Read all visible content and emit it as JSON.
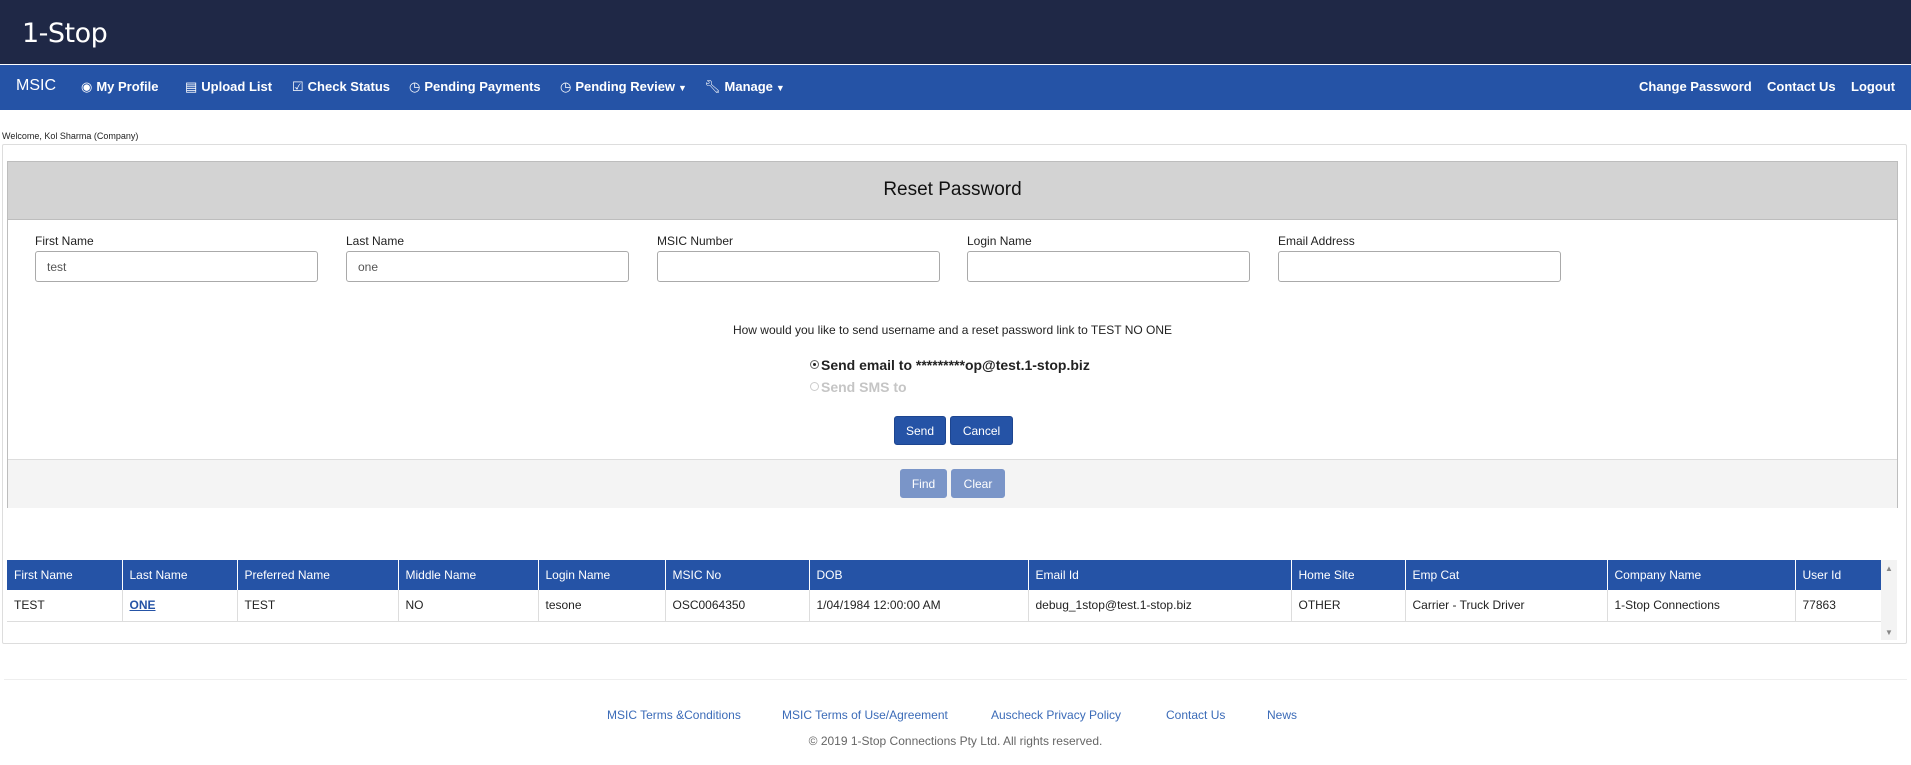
{
  "app": {
    "logo": "1-Stop"
  },
  "nav": {
    "brand": "MSIC",
    "left_items": [
      {
        "label": "My Profile",
        "icon": "user-circle-icon"
      },
      {
        "label": "Upload List",
        "icon": "document-icon"
      },
      {
        "label": "Check Status",
        "icon": "checkbox-icon"
      },
      {
        "label": "Pending Payments",
        "icon": "clock-icon"
      },
      {
        "label": "Pending Review",
        "icon": "clock-icon",
        "dropdown": true
      },
      {
        "label": "Manage",
        "icon": "wrench-icon",
        "dropdown": true
      }
    ],
    "right_items": [
      "Change Password",
      "Contact Us",
      "Logout"
    ]
  },
  "welcome": "Welcome, Kol Sharma (Company)",
  "form": {
    "title": "Reset Password",
    "fields": [
      {
        "label": "First Name",
        "value": "test"
      },
      {
        "label": "Last Name",
        "value": "one"
      },
      {
        "label": "MSIC Number",
        "value": ""
      },
      {
        "label": "Login Name",
        "value": ""
      },
      {
        "label": "Email Address",
        "value": ""
      }
    ],
    "question": "How would you like to send username and a reset password link to TEST NO ONE",
    "options": [
      {
        "label": "Send email to *********op@test.1-stop.biz",
        "checked": true,
        "disabled": false
      },
      {
        "label": "Send SMS to",
        "checked": false,
        "disabled": true
      }
    ],
    "send_label": "Send",
    "cancel_label": "Cancel",
    "find_label": "Find",
    "clear_label": "Clear"
  },
  "table": {
    "columns": [
      "First Name",
      "Last Name",
      "Preferred Name",
      "Middle Name",
      "Login Name",
      "MSIC No",
      "DOB",
      "Email Id",
      "Home Site",
      "Emp Cat",
      "Company Name",
      "User Id"
    ],
    "rows": [
      [
        "TEST",
        "ONE",
        "TEST",
        "NO",
        "tesone",
        "OSC0064350",
        "1/04/1984 12:00:00 AM",
        "debug_1stop@test.1-stop.biz",
        "OTHER",
        "Carrier - Truck Driver",
        "1-Stop Connections",
        "77863"
      ]
    ]
  },
  "footer": {
    "links": [
      "MSIC Terms &Conditions",
      "MSIC Terms of Use/Agreement",
      "Auscheck Privacy Policy",
      "Contact Us",
      "News"
    ],
    "copyright": "© 2019 1-Stop Connections Pty Ltd. All rights reserved."
  },
  "colors": {
    "topbar": "#1f2846",
    "nav": "#2553a6",
    "link": "#3b6bb8"
  }
}
